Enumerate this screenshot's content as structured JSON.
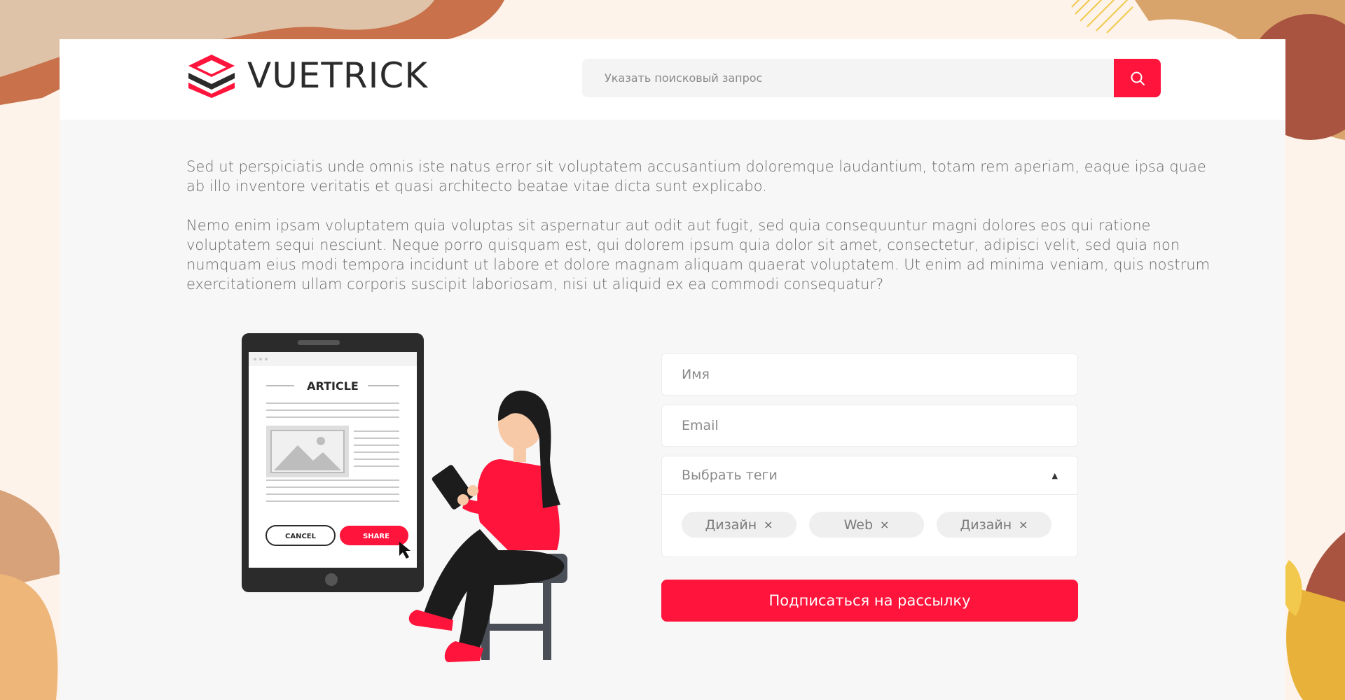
{
  "header": {
    "logo_text": "VUETRICK",
    "search": {
      "placeholder": "Указать поисковый запрос",
      "value": ""
    }
  },
  "content": {
    "paragraphs": [
      "Sed ut perspiciatis unde omnis iste natus error sit voluptatem accusantium doloremque laudantium, totam rem aperiam, eaque ipsa quae ab illo inventore veritatis et quasi architecto beatae vitae dicta sunt explicabo.",
      "Nemo enim ipsam voluptatem quia voluptas sit aspernatur aut odit aut fugit, sed quia consequuntur magni dolores eos qui ratione voluptatem sequi nesciunt. Neque porro quisquam est, qui dolorem ipsum quia dolor sit amet, consectetur, adipisci velit, sed quia non numquam eius modi tempora incidunt ut labore et dolore magnam aliquam quaerat voluptatem. Ut enim ad minima veniam, quis nostrum exercitationem ullam corporis suscipit laboriosam, nisi ut aliquid ex ea commodi consequatur?"
    ]
  },
  "illustration": {
    "article_title": "ARTICLE",
    "cancel_label": "CANCEL",
    "share_label": "SHARE"
  },
  "form": {
    "name_placeholder": "Имя",
    "email_placeholder": "Email",
    "tags_placeholder": "Выбрать теги",
    "tags": [
      "Дизайн",
      "Web",
      "Дизайн"
    ],
    "remove_glyph": "×",
    "submit_label": "Подписаться на рассылку"
  },
  "colors": {
    "accent": "#ff143c",
    "background": "#fdf3ea",
    "panel": "#f7f7f7"
  },
  "icons": [
    "logo-mark-icon",
    "search-icon",
    "dropdown-arrow-icon",
    "tag-remove-icon"
  ]
}
